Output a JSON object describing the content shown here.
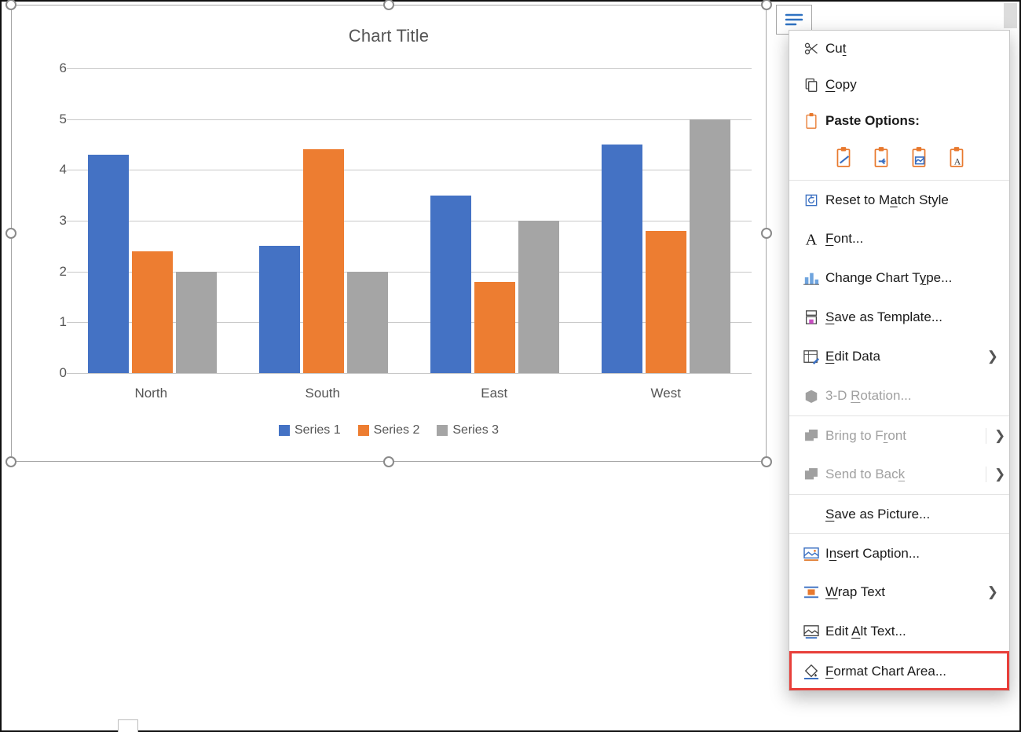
{
  "chart_title": "Chart Title",
  "chart_data": {
    "type": "bar",
    "title": "Chart Title",
    "categories": [
      "North",
      "South",
      "East",
      "West"
    ],
    "series": [
      {
        "name": "Series 1",
        "values": [
          4.3,
          2.5,
          3.5,
          4.5
        ],
        "color": "#4472C4"
      },
      {
        "name": "Series 2",
        "values": [
          2.4,
          4.4,
          1.8,
          2.8
        ],
        "color": "#ED7D31"
      },
      {
        "name": "Series 3",
        "values": [
          2.0,
          2.0,
          3.0,
          5.0
        ],
        "color": "#A5A5A5"
      }
    ],
    "ylim": [
      0,
      6
    ],
    "yticks": [
      0,
      1,
      2,
      3,
      4,
      5,
      6
    ],
    "xlabel": "",
    "ylabel": "",
    "grid": "y",
    "legend_position": "bottom"
  },
  "menu": {
    "cut": "Cut",
    "copy": "Copy",
    "paste_options": "Paste Options:",
    "reset": "Reset to Match Style",
    "font": "Font...",
    "change_chart": "Change Chart Type...",
    "save_template": "Save as Template...",
    "edit_data": "Edit Data",
    "rotation_3d": "3-D Rotation...",
    "bring_front": "Bring to Front",
    "send_back": "Send to Back",
    "save_pic": "Save as Picture...",
    "insert_caption": "Insert Caption...",
    "wrap_text": "Wrap Text",
    "alt_text": "Edit Alt Text...",
    "format_chart_area": "Format Chart Area..."
  }
}
